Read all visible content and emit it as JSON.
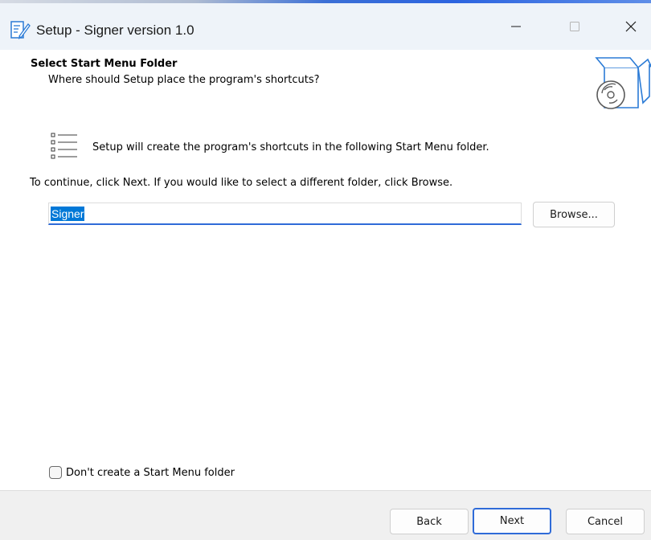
{
  "window": {
    "title": "Setup - Signer version 1.0",
    "accent_color": "#2f6bd8",
    "controls": {
      "minimize_icon": "minimize-icon",
      "maximize_icon": "maximize-icon",
      "close_icon": "close-icon"
    }
  },
  "header": {
    "title": "Select Start Menu Folder",
    "subtitle": "Where should Setup place the program's shortcuts?",
    "image_icon": "box-with-disc-icon"
  },
  "main": {
    "info_icon": "list-icon",
    "info_text": "Setup will create the program's shortcuts in the following Start Menu folder.",
    "instruction_text": "To continue, click Next. If you would like to select a different folder, click Browse.",
    "folder_value": "Signer",
    "browse_label": "Browse..."
  },
  "options": {
    "no_folder_label": "Don't create a Start Menu folder",
    "no_folder_checked": false
  },
  "footer": {
    "back_label": "Back",
    "next_label": "Next",
    "cancel_label": "Cancel"
  }
}
